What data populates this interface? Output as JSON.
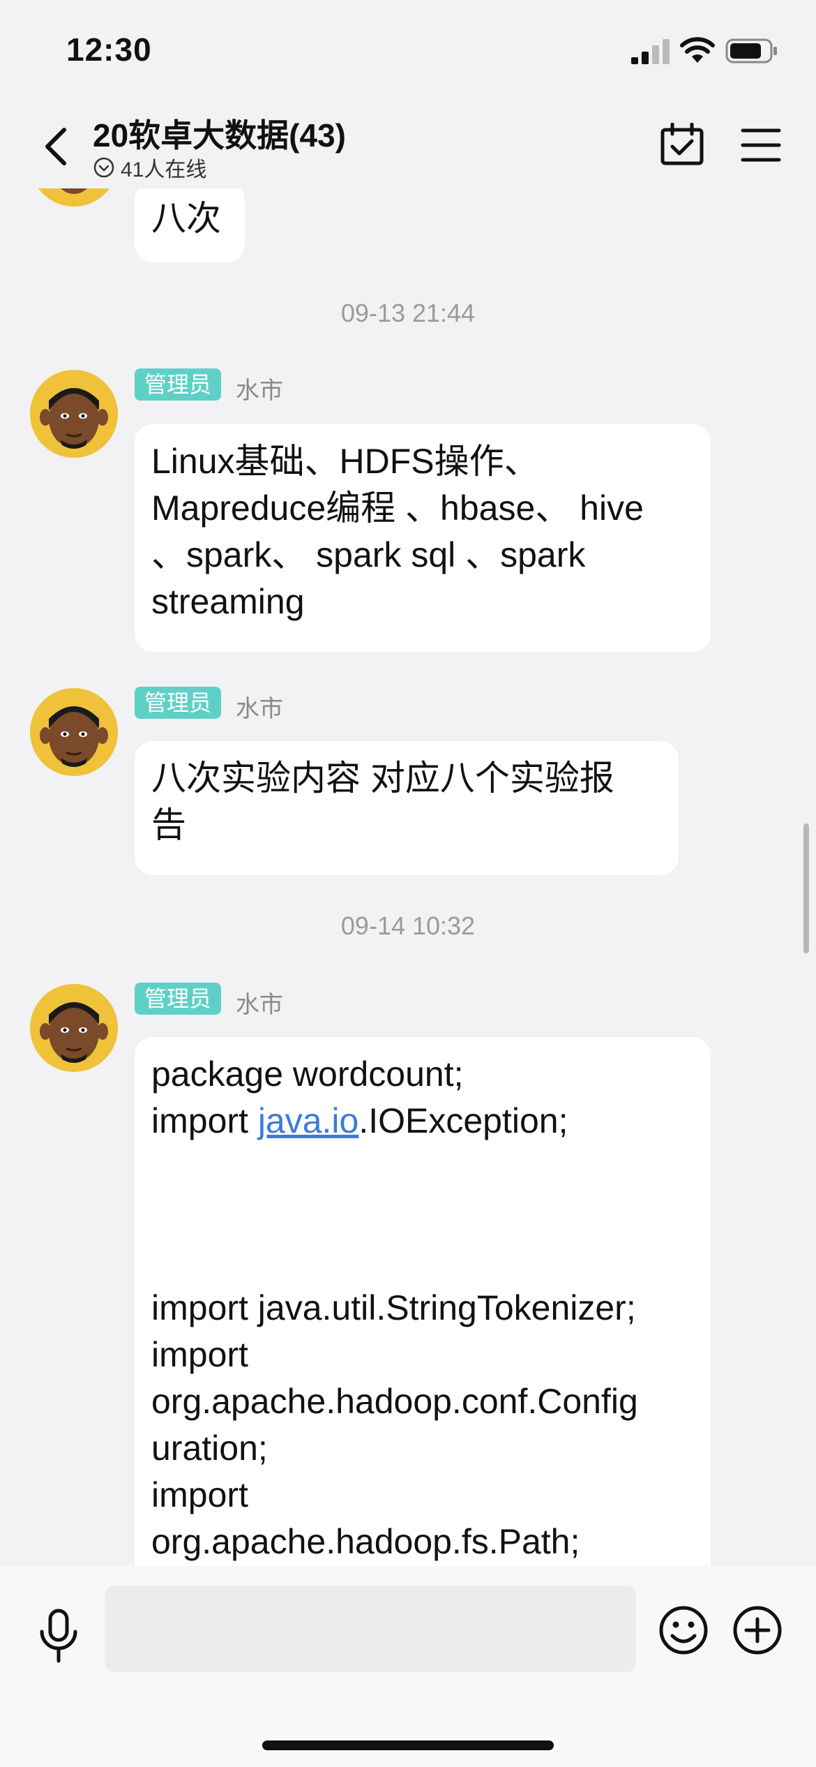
{
  "status": {
    "time": "12:30"
  },
  "header": {
    "title": "20软卓大数据(43)",
    "online": "41人在线"
  },
  "messages": [
    {
      "text": "八次"
    },
    {
      "timestamp": "09-13 21:44",
      "tag": "管理员",
      "sender": "水市",
      "lines": [
        "Linux基础、HDFS操作、",
        "Mapreduce编程 、hbase、 hive",
        "、spark、 spark sql 、spark",
        "streaming"
      ]
    },
    {
      "tag": "管理员",
      "sender": "水市",
      "lines": [
        "八次实验内容 对应八个实验报",
        "告"
      ]
    },
    {
      "timestamp": "09-14 10:32",
      "tag": "管理员",
      "sender": "水市",
      "code": {
        "line1": "package wordcount;",
        "import_prefix": "import ",
        "link": "java.io",
        "import_suffix": ".IOException;",
        "lines": [
          "import java.util.StringTokenizer;",
          "import",
          "org.apache.hadoop.conf.Config",
          "uration;",
          "import",
          "org.apache.hadoop.fs.Path;"
        ]
      }
    }
  ],
  "colors": {
    "tag_bg": "#5fd0c6",
    "link": "#3d7bd8",
    "avatar_bg": "#f0c23a"
  }
}
